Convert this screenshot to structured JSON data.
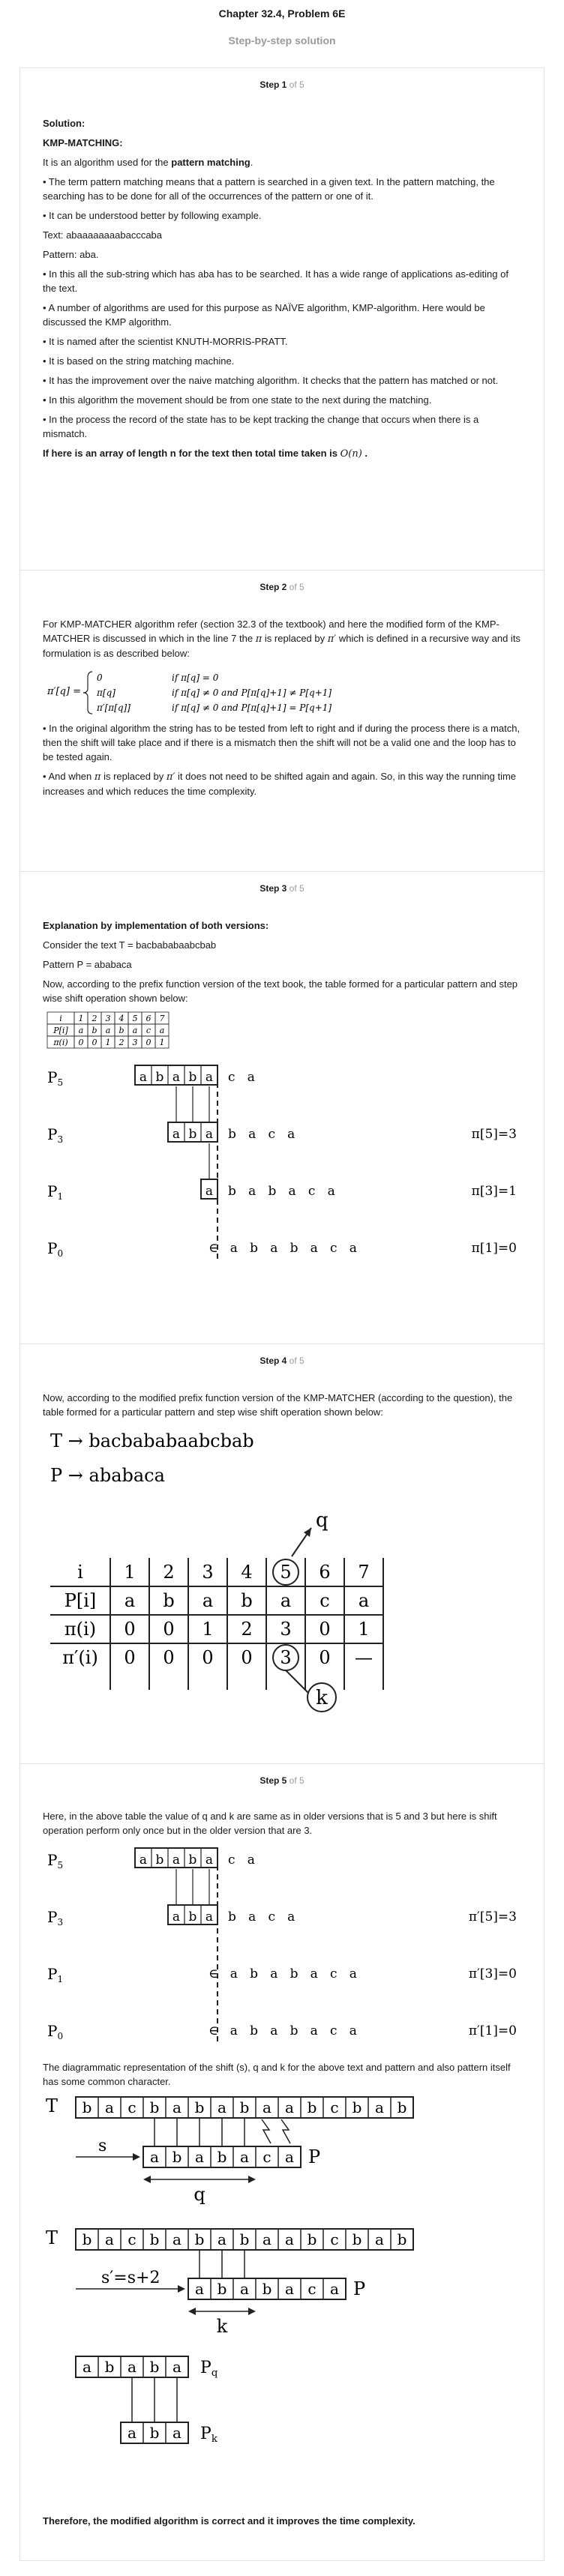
{
  "header": {
    "title": "Chapter 32.4, Problem 6E",
    "subtitle": "Step-by-step solution"
  },
  "steps": [
    {
      "label": "Step 1",
      "of": "of 5"
    },
    {
      "label": "Step 2",
      "of": "of 5"
    },
    {
      "label": "Step 3",
      "of": "of 5"
    },
    {
      "label": "Step 4",
      "of": "of 5"
    },
    {
      "label": "Step 5",
      "of": "of 5"
    }
  ],
  "step1": {
    "solution": "Solution:",
    "heading": "KMP-MATCHING:",
    "intro_pre": "It is an algorithm used for the ",
    "intro_bold": "pattern matching",
    "intro_post": ".",
    "p1": "• The term pattern matching means that a pattern is searched in a given text. In the pattern matching, the searching has to be done for all of the occurrences of the pattern or one of it.",
    "p2": "• It can be understood better by following example.",
    "text_line": "Text: abaaaaaaaabacccaba",
    "pattern_line": "Pattern: aba.",
    "p3": "• In this all the sub-string which has aba has to be searched. It has a wide range of applications as-editing of the text.",
    "p4": "• A number of algorithms are used for this purpose as NAÏVE algorithm, KMP-algorithm. Here would be discussed the KMP algorithm.",
    "p5": "• It is named after the scientist KNUTH-MORRIS-PRATT.",
    "p6": "• It is based on the string matching machine.",
    "p7": "• It has the improvement over the naive matching algorithm. It checks that the pattern has matched or not.",
    "p8": "• In this algorithm the movement should be from one state to the next during the matching.",
    "p9": "• In the process the record of the state has to be kept tracking the change that occurs when there is a mismatch.",
    "conclusion": "If here is an array of length n for the text then total time taken is",
    "complexity": "O(n)"
  },
  "step2": {
    "p1": "For KMP-MATCHER algorithm refer (section 32.3 of the textbook) and here the modified form of the KMP-MATCHER is discussed in which in the line 7 the",
    "p1_mid": "is replaced by",
    "p1_end": "which is defined in a recursive way and its formulation is as described below:",
    "formula_lhs": "π′[q] =",
    "case1_val": "0",
    "case1_cond": "if π[q] = 0",
    "case2_val": "π[q]",
    "case2_cond": "if π[q] ≠ 0 and P[π[q]+1] ≠ P[q+1]",
    "case3_val": "π′[π[q]]",
    "case3_cond": "if π[q] ≠ 0 and P[π[q]+1] = P[q+1]",
    "p2": "• In the original algorithm the string has to be tested from left to right and if during the process there is a match, then the shift will take place and if there is a mismatch then the shift will not be a valid one and the loop has to be tested again.",
    "p3_pre": "• And when",
    "p3_mid": "is replaced by",
    "p3_post": "it does not need to be shifted again and again. So, in this way the running time increases and which reduces the time complexity.",
    "pi": "π",
    "pi_prime": "π′"
  },
  "step3": {
    "heading": "Explanation by implementation of both versions:",
    "text_line": "Consider the text T = bacbababaabcbab",
    "pattern_line": "Pattern P = ababaca",
    "p1": "Now, according to the prefix function version of the text book, the table formed for a particular pattern and step wise shift operation shown below:",
    "table": {
      "rows": [
        [
          "i",
          "1",
          "2",
          "3",
          "4",
          "5",
          "6",
          "7"
        ],
        [
          "P[i]",
          "a",
          "b",
          "a",
          "b",
          "a",
          "c",
          "a"
        ],
        [
          "π(i)",
          "0",
          "0",
          "1",
          "2",
          "3",
          "0",
          "1"
        ]
      ]
    },
    "shifts": [
      {
        "label": "P5",
        "boxes": [
          "a",
          "b",
          "a",
          "b",
          "a"
        ],
        "rest": "c  a",
        "note": ""
      },
      {
        "label": "P3",
        "boxes": [
          "a",
          "b",
          "a"
        ],
        "rest": "b  a  c  a",
        "note": "π[5]=3"
      },
      {
        "label": "P1",
        "boxes": [
          "a"
        ],
        "rest": "b  a  b  a  c  a",
        "note": "π[3]=1"
      },
      {
        "label": "P0",
        "boxes": [],
        "rest": "∈  a  b  a  b  a  c  a",
        "note": "π[1]=0"
      }
    ]
  },
  "step4": {
    "p1": "Now, according to the modified prefix function version of the KMP-MATCHER (according to the question), the table formed for a particular pattern and step wise shift operation shown below:",
    "t_line": "T → bacbababaabcbab",
    "p_line": "P → ababaca",
    "q_label": "q",
    "k_label": "k",
    "table": {
      "rows": [
        [
          "i",
          "1",
          "2",
          "3",
          "4",
          "5",
          "6",
          "7"
        ],
        [
          "P[i]",
          "a",
          "b",
          "a",
          "b",
          "a",
          "c",
          "a"
        ],
        [
          "π(i)",
          "0",
          "0",
          "1",
          "2",
          "3",
          "0",
          "1"
        ],
        [
          "π′(i)",
          "0",
          "0",
          "0",
          "0",
          "3",
          "0",
          "—"
        ]
      ]
    }
  },
  "step5": {
    "p1": "Here, in the above table the value of q and k are same as in older versions that is 5 and 3 but here is shift operation perform only once but in the older version that are 3.",
    "shifts": [
      {
        "label": "P5",
        "boxes": [
          "a",
          "b",
          "a",
          "b",
          "a"
        ],
        "rest": "c  a",
        "note": ""
      },
      {
        "label": "P3",
        "boxes": [
          "a",
          "b",
          "a"
        ],
        "rest": "b  a  c  a",
        "note": "π′[5]=3"
      },
      {
        "label": "P1",
        "boxes": [],
        "rest": "∈  a  b  a  b  a  c  a",
        "note": "π′[3]=0"
      },
      {
        "label": "P0",
        "boxes": [],
        "rest": "∈  a  b  a  b  a  c  a",
        "note": "π′[1]=0"
      }
    ],
    "p2": "The diagrammatic representation of the shift (s), q and k for the above text and pattern and also pattern itself has some common character.",
    "text_chars": [
      "b",
      "a",
      "c",
      "b",
      "a",
      "b",
      "a",
      "b",
      "a",
      "a",
      "b",
      "c",
      "b",
      "a",
      "b"
    ],
    "pattern_chars": [
      "a",
      "b",
      "a",
      "b",
      "a",
      "c",
      "a"
    ],
    "T": "T",
    "P": "P",
    "s_label": "s",
    "q_label": "q",
    "s2_label": "s′=s+2",
    "k_label": "k",
    "pq_chars": [
      "a",
      "b",
      "a",
      "b",
      "a"
    ],
    "pk_chars": [
      "a",
      "b",
      "a"
    ],
    "pq_label": "Pq",
    "pk_label": "Pk",
    "conclusion": "Therefore, the modified algorithm is correct and it improves the time complexity."
  }
}
